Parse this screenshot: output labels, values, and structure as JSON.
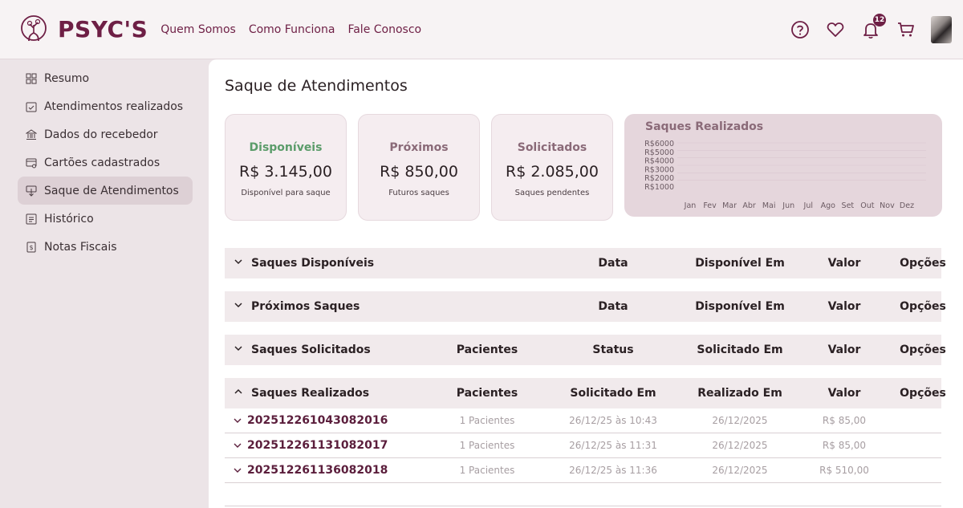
{
  "brand": {
    "name": "PSYC'S"
  },
  "nav": [
    {
      "label": "Quem Somos"
    },
    {
      "label": "Como Funciona"
    },
    {
      "label": "Fale Conosco"
    }
  ],
  "header": {
    "notifications_count": "12",
    "icons": [
      "help-icon",
      "heart-icon",
      "bell-icon",
      "cart-icon"
    ]
  },
  "sidebar": {
    "items": [
      {
        "label": "Resumo",
        "icon": "dashboard-icon"
      },
      {
        "label": "Atendimentos realizados",
        "icon": "calendar-check-icon"
      },
      {
        "label": "Dados do recebedor",
        "icon": "bank-icon"
      },
      {
        "label": "Cartões cadastrados",
        "icon": "card-icon"
      },
      {
        "label": "Saque de Atendimentos",
        "icon": "withdraw-icon",
        "active": true
      },
      {
        "label": "Histórico",
        "icon": "history-icon"
      },
      {
        "label": "Notas Fiscais",
        "icon": "invoice-icon"
      }
    ]
  },
  "page": {
    "title": "Saque de Atendimentos"
  },
  "cards": [
    {
      "title": "Disponíveis",
      "amount": "R$ 3.145,00",
      "sub": "Disponível para saque",
      "color": "#5b9c6a"
    },
    {
      "title": "Próximos",
      "amount": "R$ 850,00",
      "sub": "Futuros saques",
      "color": "#8a6a78"
    },
    {
      "title": "Solicitados",
      "amount": "R$ 2.085,00",
      "sub": "Saques pendentes",
      "color": "#8a6a78"
    }
  ],
  "chart_data": {
    "type": "bar",
    "title": "Saques Realizados",
    "categories": [
      "Jan",
      "Fev",
      "Mar",
      "Abr",
      "Mai",
      "Jun",
      "Jul",
      "Ago",
      "Set",
      "Out",
      "Nov",
      "Dez"
    ],
    "values": [
      0,
      0,
      0,
      0,
      0,
      0,
      0,
      0,
      0,
      0,
      0,
      0
    ],
    "y_tick_labels": [
      "R$6000",
      "R$5000",
      "R$4000",
      "R$3000",
      "R$2000",
      "R$1000"
    ],
    "y_ticks": [
      6000,
      5000,
      4000,
      3000,
      2000,
      1000
    ],
    "ylim": [
      0,
      6000
    ],
    "grid": true
  },
  "sections": [
    {
      "title": "Saques Disponíveis",
      "expanded": false,
      "columns": [
        "Data",
        "Disponível Em",
        "Valor",
        "Opções"
      ]
    },
    {
      "title": "Próximos Saques",
      "expanded": false,
      "columns": [
        "Data",
        "Disponível Em",
        "Valor",
        "Opções"
      ]
    },
    {
      "title": "Saques Solicitados",
      "expanded": false,
      "columns": [
        "Pacientes",
        "Status",
        "Solicitado Em",
        "Valor",
        "Opções"
      ]
    },
    {
      "title": "Saques Realizados",
      "expanded": true,
      "columns": [
        "Pacientes",
        "Solicitado Em",
        "Realizado Em",
        "Valor",
        "Opções"
      ]
    }
  ],
  "realizados": [
    {
      "id": "202512261043082016",
      "pacientes": "1 Pacientes",
      "solicitado": "26/12/25 às 10:43",
      "realizado": "26/12/2025",
      "valor": "R$ 85,00"
    },
    {
      "id": "202512261131082017",
      "pacientes": "1 Pacientes",
      "solicitado": "26/12/25 às 11:31",
      "realizado": "26/12/2025",
      "valor": "R$ 85,00"
    },
    {
      "id": "202512261136082018",
      "pacientes": "1 Pacientes",
      "solicitado": "26/12/25 às 11:36",
      "realizado": "26/12/2025",
      "valor": "R$ 510,00"
    }
  ]
}
